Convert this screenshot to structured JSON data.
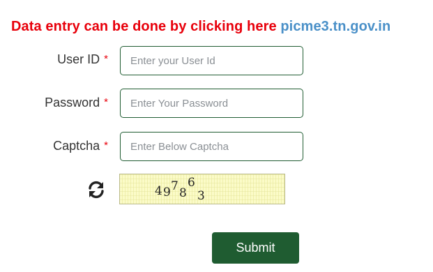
{
  "notice": {
    "lead_text": "Data entry can be done by clicking here",
    "link_text": "picme3.tn.gov.in"
  },
  "form": {
    "required_marker": "*",
    "user_id": {
      "label": "User ID",
      "placeholder": "Enter your User Id",
      "value": ""
    },
    "password": {
      "label": "Password",
      "placeholder": "Enter Your Password",
      "value": ""
    },
    "captcha": {
      "label": "Captcha",
      "placeholder": "Enter Below Captcha",
      "value": ""
    },
    "captcha_image": {
      "digits": [
        "4",
        "9",
        "7",
        "8",
        "6",
        "3"
      ]
    },
    "refresh_icon": "refresh-icon",
    "submit_label": "Submit"
  },
  "colors": {
    "notice_red": "#e8000b",
    "link_blue": "#4a90c8",
    "accent_green": "#1f5c31",
    "captcha_bg": "#fbfbc8"
  }
}
